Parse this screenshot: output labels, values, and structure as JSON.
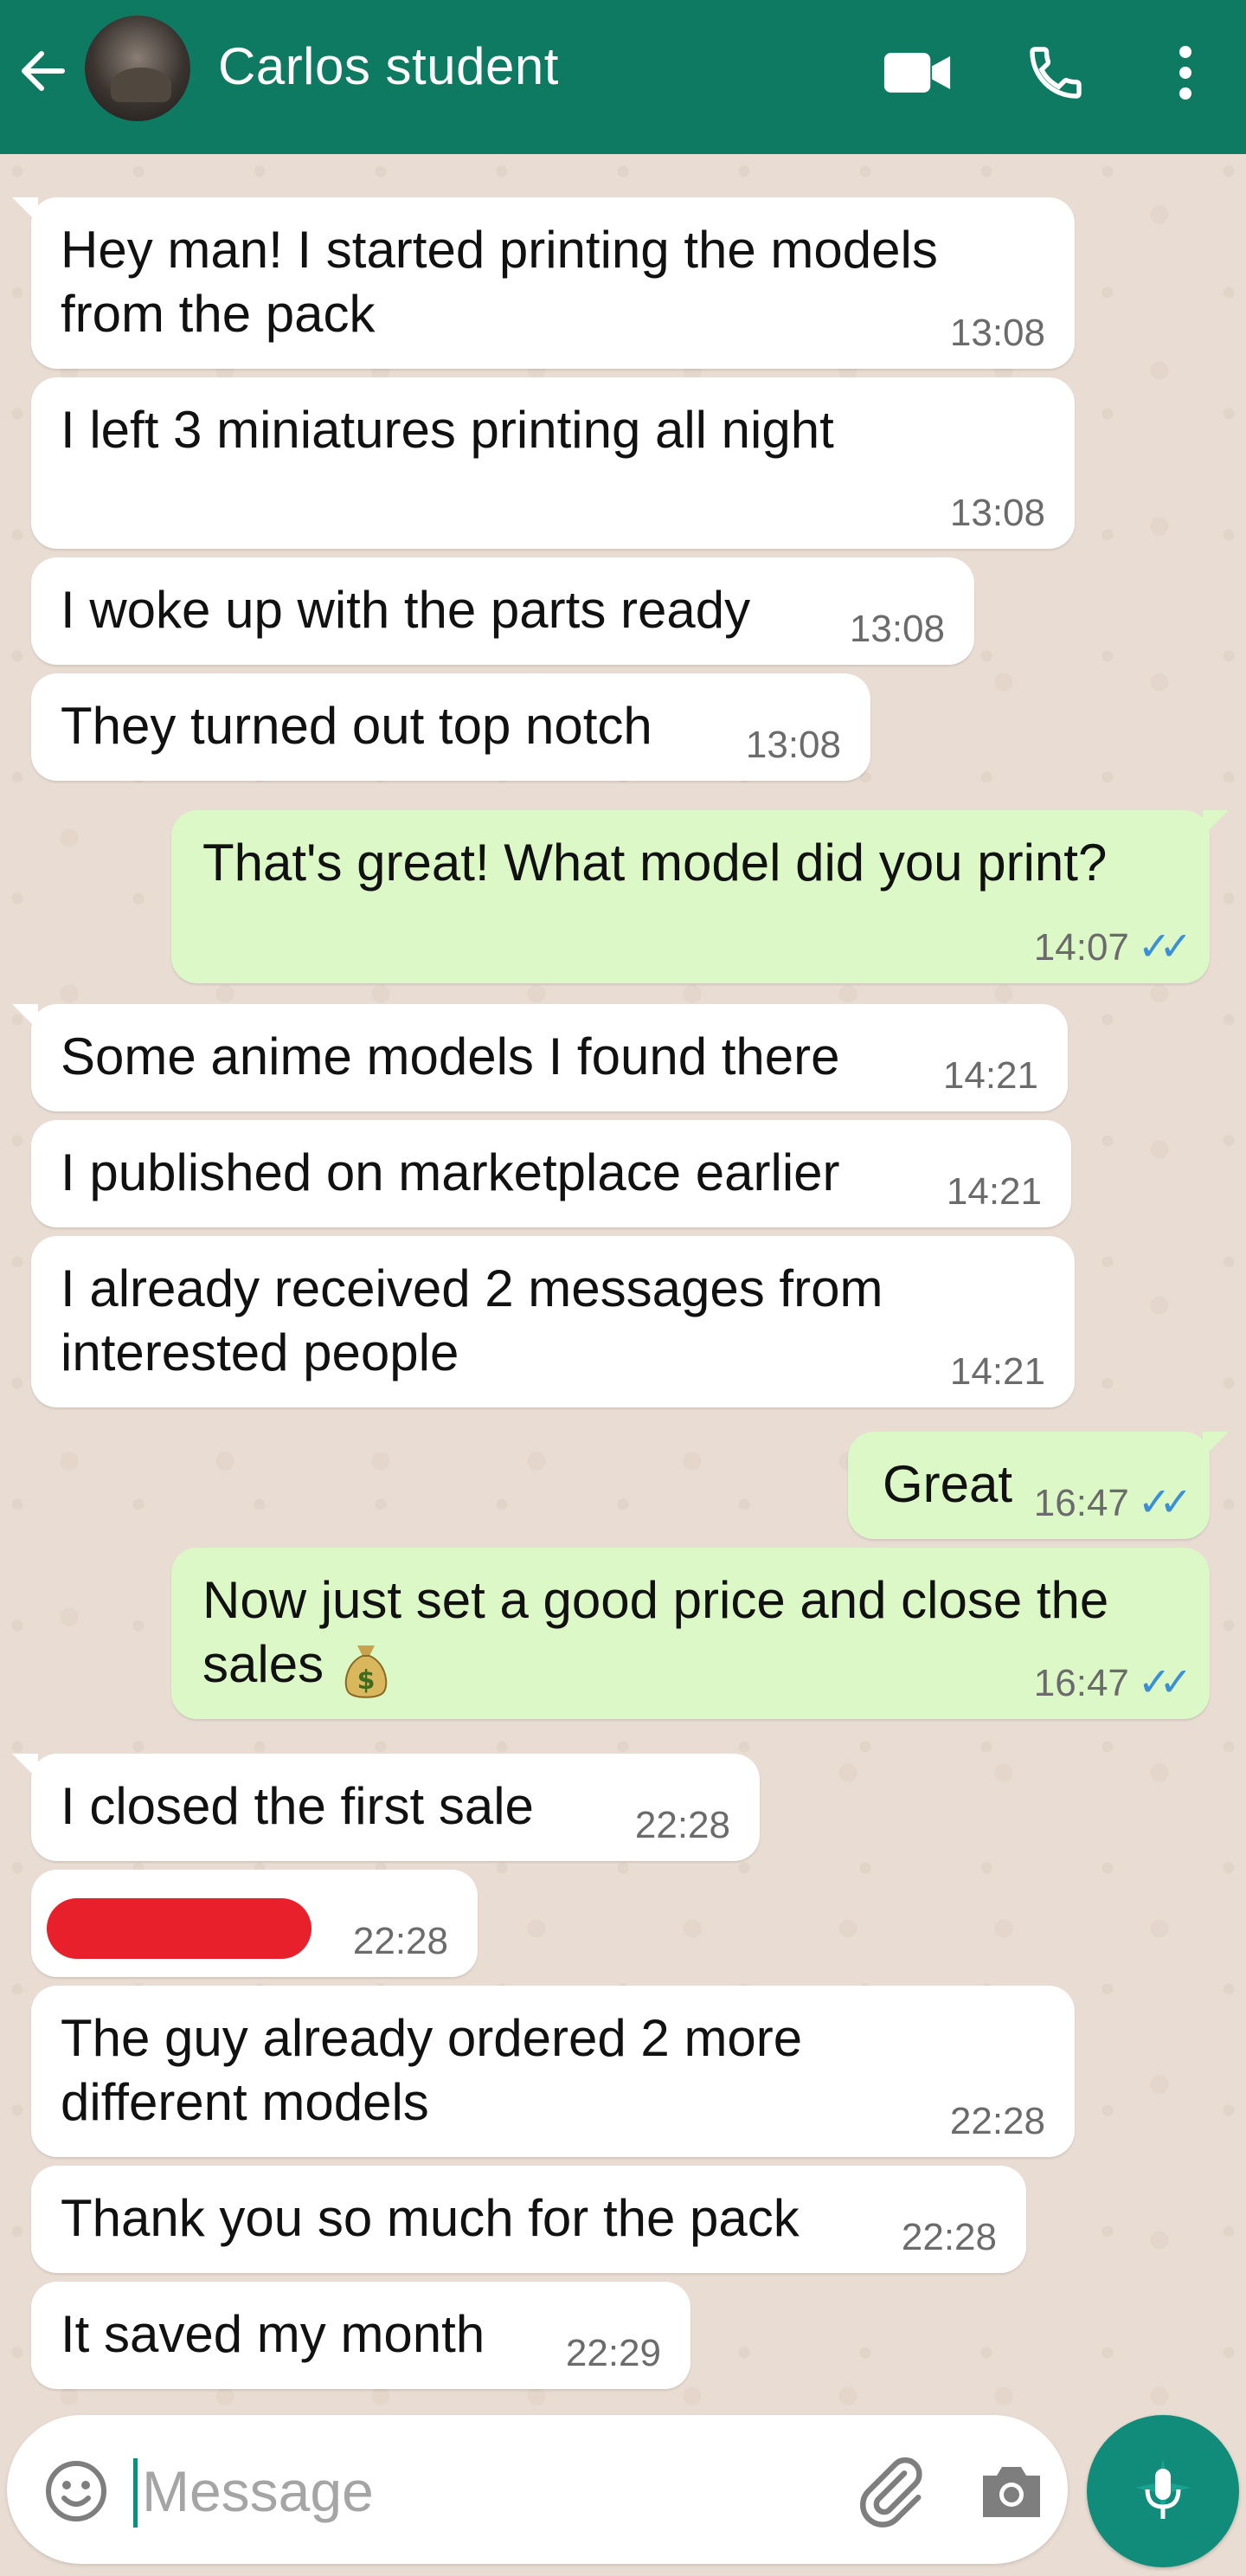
{
  "header": {
    "contact_name": "Carlos student"
  },
  "colors": {
    "header": "#0f7a62",
    "incoming_bubble": "#ffffff",
    "outgoing_bubble": "#dcf8c6",
    "read_ticks": "#3a8fd6",
    "mic_button": "#118c7b",
    "redaction": "#e8202b"
  },
  "icons": {
    "back": "arrow-left-icon",
    "video": "video-camera-icon",
    "call": "phone-icon",
    "menu": "more-vertical-icon",
    "emoji": "emoji-icon",
    "attach": "paperclip-icon",
    "camera": "camera-icon",
    "mic": "microphone-icon"
  },
  "messages": [
    {
      "dir": "in",
      "line1": "Hey man! I started printing the models",
      "line2": "from the pack",
      "time": "13:08"
    },
    {
      "dir": "in",
      "text": "I left 3 miniatures printing all night",
      "time": "13:08"
    },
    {
      "dir": "in",
      "text": "I woke up with the parts ready",
      "time": "13:08"
    },
    {
      "dir": "in",
      "text": "They turned out top notch",
      "time": "13:08"
    },
    {
      "dir": "out",
      "text": "That's great! What model did you print?",
      "time": "14:07",
      "status": "read"
    },
    {
      "dir": "in",
      "text": "Some anime models I found there",
      "time": "14:21"
    },
    {
      "dir": "in",
      "text": "I published on marketplace earlier",
      "time": "14:21"
    },
    {
      "dir": "in",
      "line1": "I already received 2 messages from",
      "line2": "interested people",
      "time": "14:21"
    },
    {
      "dir": "out",
      "text": "Great",
      "time": "16:47",
      "status": "read"
    },
    {
      "dir": "out",
      "line1": "Now just set a good price and close the",
      "line2": "sales",
      "time": "16:47",
      "status": "read"
    },
    {
      "dir": "in",
      "text": "I closed the first sale",
      "time": "22:28"
    },
    {
      "dir": "in",
      "text": "",
      "redacted": true,
      "time": "22:28"
    },
    {
      "dir": "in",
      "line1": "The guy already ordered 2 more",
      "line2": "different models",
      "time": "22:28"
    },
    {
      "dir": "in",
      "text": "Thank you so much for the pack",
      "time": "22:28"
    },
    {
      "dir": "in",
      "text": "It saved my month",
      "time": "22:29"
    }
  ],
  "composer": {
    "placeholder": "Message"
  }
}
